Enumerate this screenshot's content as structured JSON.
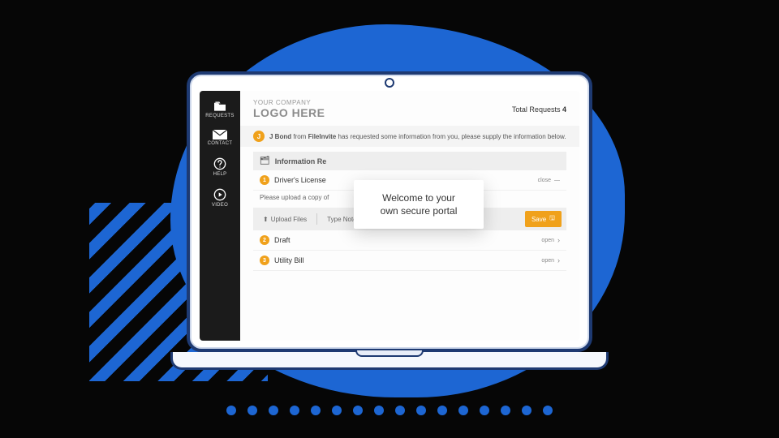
{
  "sidebar": {
    "items": [
      {
        "label": "REQUESTS",
        "icon": "folder"
      },
      {
        "label": "CONTACT",
        "icon": "mail"
      },
      {
        "label": "HELP",
        "icon": "help"
      },
      {
        "label": "VIDEO",
        "icon": "play"
      }
    ]
  },
  "header": {
    "logo_line1": "YOUR COMPANY",
    "logo_line2": "LOGO HERE",
    "total_requests_label": "Total Requests",
    "total_requests_count": "4"
  },
  "info": {
    "avatar_initial": "J",
    "sender_name": "J Bond",
    "from_word": "from",
    "company": "FileInvite",
    "message_tail": "has requested some information from you, please supply the information below."
  },
  "section_header": "Information Re",
  "requests": [
    {
      "num": "1",
      "title": "Driver's License",
      "note": "Please upload a copy of",
      "action": "close"
    },
    {
      "num": "2",
      "title": "Draft",
      "action": "open"
    },
    {
      "num": "3",
      "title": "Utility Bill",
      "action": "open"
    }
  ],
  "toolbar": {
    "upload_label": "Upload Files",
    "note_label": "Type Note",
    "save_label": "Save"
  },
  "tooltip": {
    "line1": "Welcome to your",
    "line2": "own secure portal"
  }
}
